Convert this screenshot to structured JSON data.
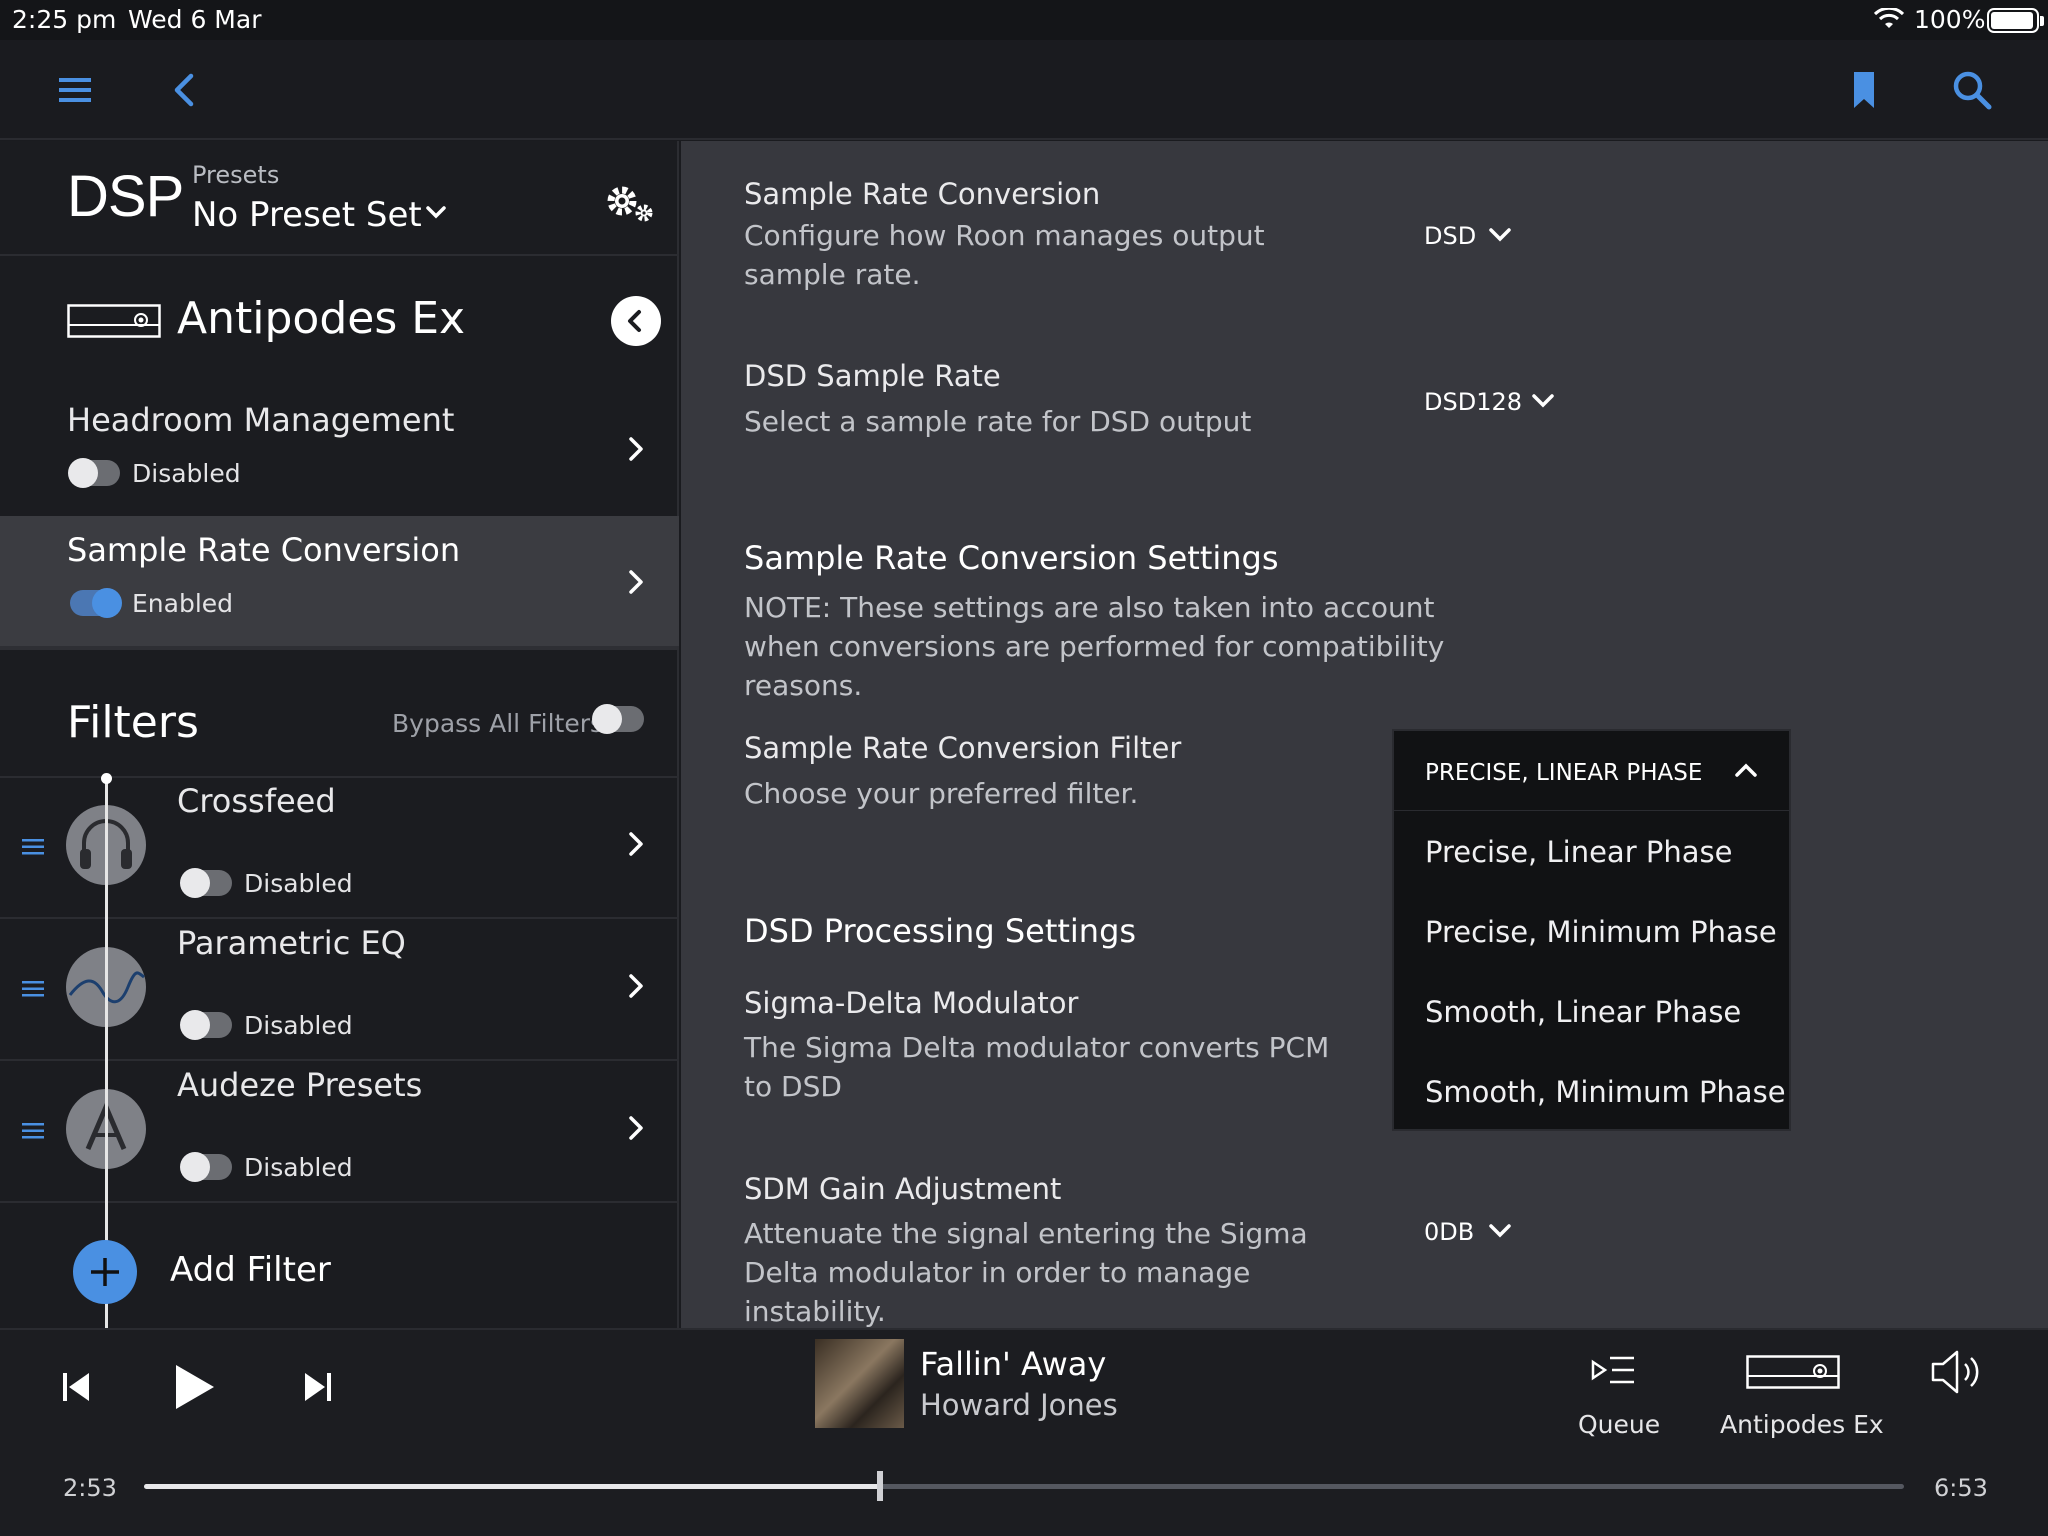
{
  "status_bar": {
    "time": "2:25 pm",
    "date": "Wed 6 Mar",
    "battery": "100%"
  },
  "colors": {
    "accent": "#4a90e2",
    "left_bg": "#1b1c20",
    "right_bg": "#37383e",
    "selected_row": "#3b3c41"
  },
  "dsp": {
    "title": "DSP",
    "presets_label": "Presets",
    "preset_value": "No Preset Set",
    "zone_name": "Antipodes Ex"
  },
  "left_items": [
    {
      "label": "Headroom Management",
      "status": "Disabled",
      "enabled": false
    },
    {
      "label": "Sample Rate Conversion",
      "status": "Enabled",
      "enabled": true
    }
  ],
  "filters": {
    "title": "Filters",
    "bypass_label": "Bypass All Filters",
    "items": [
      {
        "label": "Crossfeed",
        "status": "Disabled",
        "icon": "headphones-icon"
      },
      {
        "label": "Parametric EQ",
        "status": "Disabled",
        "icon": "eq-curve-icon"
      },
      {
        "label": "Audeze Presets",
        "status": "Disabled",
        "icon": "audeze-logo-icon"
      }
    ],
    "add_label": "Add Filter"
  },
  "settings": {
    "src": {
      "title": "Sample Rate Conversion",
      "desc": "Configure how Roon manages output sample rate.",
      "value": "DSD"
    },
    "dsd_rate": {
      "title": "DSD Sample Rate",
      "desc": "Select a sample rate for DSD output",
      "value": "DSD128"
    },
    "src_settings": {
      "heading": "Sample Rate Conversion Settings",
      "note": "NOTE: These settings are also taken into account when conversions are performed for compatibility reasons."
    },
    "src_filter": {
      "title": "Sample Rate Conversion Filter",
      "desc": "Choose your preferred filter.",
      "value": "PRECISE, LINEAR PHASE",
      "options": [
        "Precise, Linear Phase",
        "Precise, Minimum Phase",
        "Smooth, Linear Phase",
        "Smooth, Minimum Phase"
      ]
    },
    "dsd_processing": {
      "heading": "DSD Processing Settings"
    },
    "sdm": {
      "title": "Sigma-Delta Modulator",
      "desc": "The Sigma Delta modulator converts PCM to DSD"
    },
    "sdm_gain": {
      "title": "SDM Gain Adjustment",
      "desc": "Attenuate the signal entering the Sigma Delta modulator in order to manage instability.",
      "value": "0DB"
    }
  },
  "player": {
    "track": "Fallin' Away",
    "artist": "Howard Jones",
    "queue_label": "Queue",
    "zone_label": "Antipodes Ex",
    "current_time": "2:53",
    "total_time": "6:53",
    "progress": 0.418
  }
}
